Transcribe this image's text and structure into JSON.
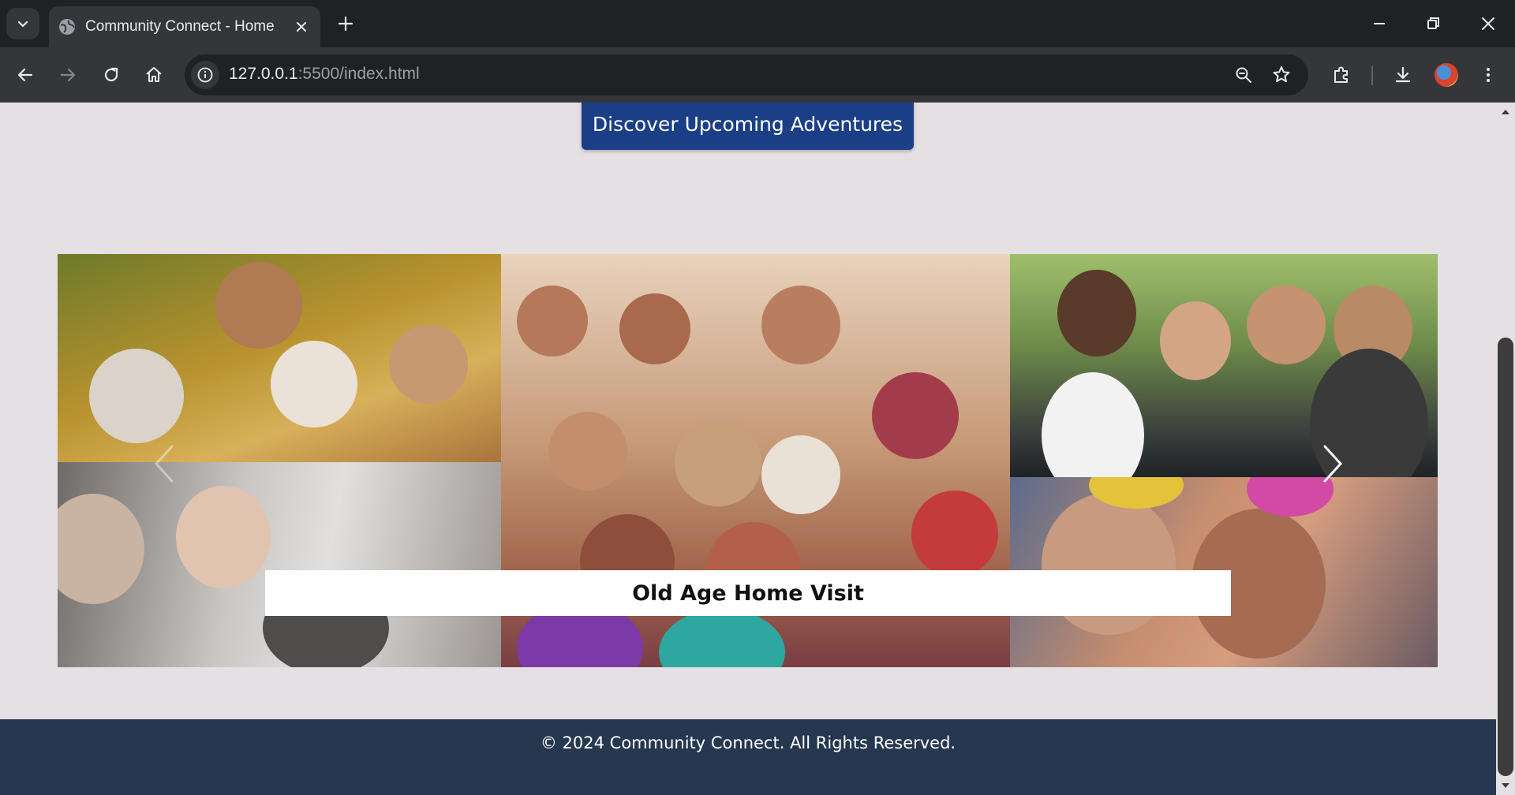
{
  "browser": {
    "tab_title": "Community Connect - Home",
    "url_host": "127.0.0.1",
    "url_rest": ":5500/index.html"
  },
  "page": {
    "cta_label": "Discover Upcoming Adventures",
    "carousel": {
      "caption": "Old Age Home Visit"
    },
    "footer_text": "© 2024 Community Connect. All Rights Reserved."
  }
}
